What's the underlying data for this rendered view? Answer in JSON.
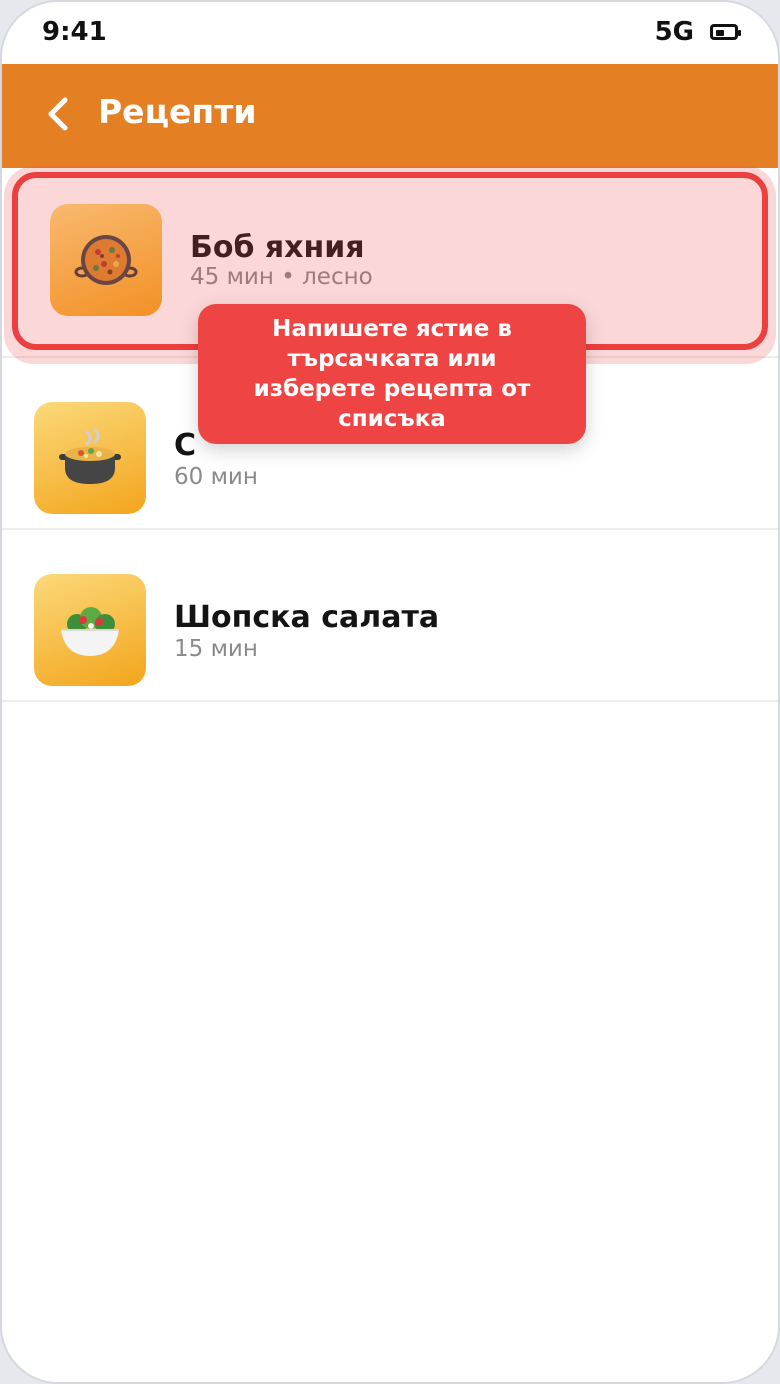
{
  "status_bar": {
    "time": "9:41",
    "network": "5G",
    "battery_icon": "battery-icon",
    "battery_level": 0.45
  },
  "app_bar": {
    "back_icon": "chevron-left-icon",
    "title": "Рецепти",
    "color": "#e47f24"
  },
  "recipes": [
    {
      "title": "Боб яхния",
      "subtitle": "45 мин • лесно",
      "icon": "paella-pan-icon"
    },
    {
      "title": "С",
      "subtitle": "60 мин",
      "icon": "pot-of-food-icon"
    },
    {
      "title": "Шопска салата",
      "subtitle": "15 мин",
      "icon": "salad-bowl-icon"
    }
  ],
  "tooltip": {
    "lines": [
      "Напишете ястие в",
      "търсачката или",
      "изберете рецепта от",
      "списъка"
    ],
    "color": "#ef4444"
  },
  "highlight_color": "#ec3f3f"
}
